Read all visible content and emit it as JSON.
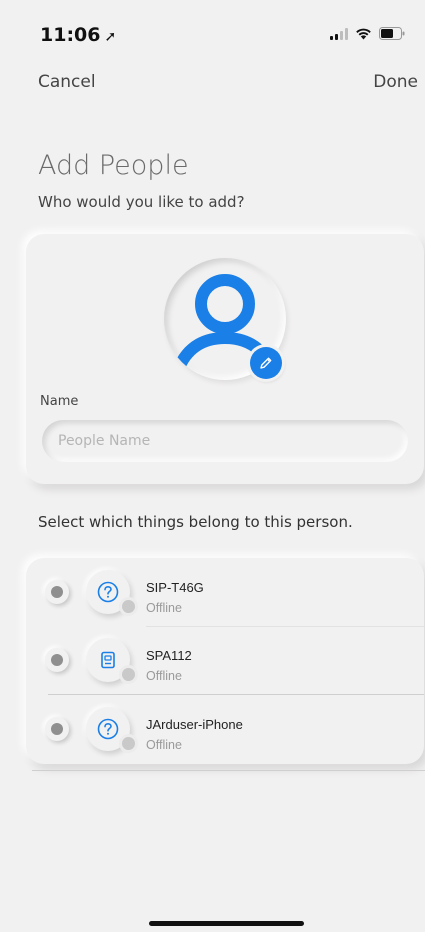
{
  "status_bar": {
    "time": "11:06",
    "location_icon": "location-arrow-icon",
    "signal_icon": "cellular-signal-icon",
    "wifi_icon": "wifi-icon",
    "battery_icon": "battery-icon"
  },
  "nav": {
    "cancel_label": "Cancel",
    "done_label": "Done"
  },
  "header": {
    "title": "Add People",
    "subtitle": "Who would you like to add?"
  },
  "profile": {
    "avatar_icon": "person-avatar-icon",
    "edit_icon": "pencil-icon",
    "name_label": "Name",
    "name_placeholder": "People Name",
    "name_value": ""
  },
  "things": {
    "instruction": "Select which things belong to this person.",
    "items": [
      {
        "name": "SIP-T46G",
        "status": "Offline",
        "icon": "unknown-device-icon"
      },
      {
        "name": "SPA112",
        "status": "Offline",
        "icon": "phone-adapter-icon"
      },
      {
        "name": "JArduser-iPhone",
        "status": "Offline",
        "icon": "unknown-device-icon"
      }
    ]
  },
  "colors": {
    "accent": "#1a7fe6",
    "background": "#f2f1f1",
    "offline_dot": "#c9c9c9"
  }
}
